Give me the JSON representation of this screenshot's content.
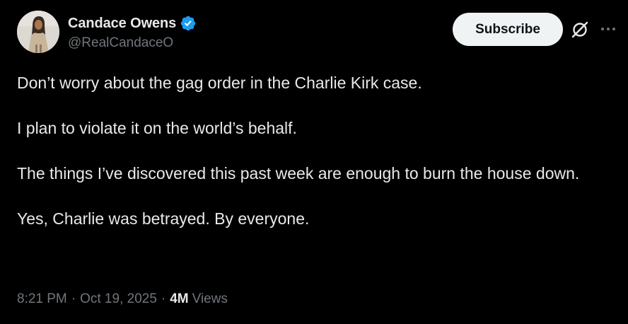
{
  "author": {
    "display_name": "Candace Owens",
    "handle": "@RealCandaceO",
    "verified": true
  },
  "actions": {
    "subscribe_label": "Subscribe"
  },
  "tweet": {
    "paragraphs": [
      "Don’t worry about the gag order in the Charlie Kirk case.",
      "I plan to violate it on the world’s behalf.",
      "The things I’ve discovered this past week are enough to burn the house down.",
      "Yes, Charlie was betrayed. By everyone."
    ]
  },
  "meta": {
    "time": "8:21 PM",
    "separator": "·",
    "date": "Oct 19, 2025",
    "views_count": "4M",
    "views_label": "Views"
  },
  "colors": {
    "background": "#000000",
    "text_primary": "#e7e9ea",
    "text_secondary": "#71767b",
    "verified_blue": "#1d9bf0",
    "button_bg": "#eff3f4"
  },
  "icons": {
    "verified": "verified-badge-icon",
    "grok": "grok-icon",
    "more": "more-options-icon"
  }
}
